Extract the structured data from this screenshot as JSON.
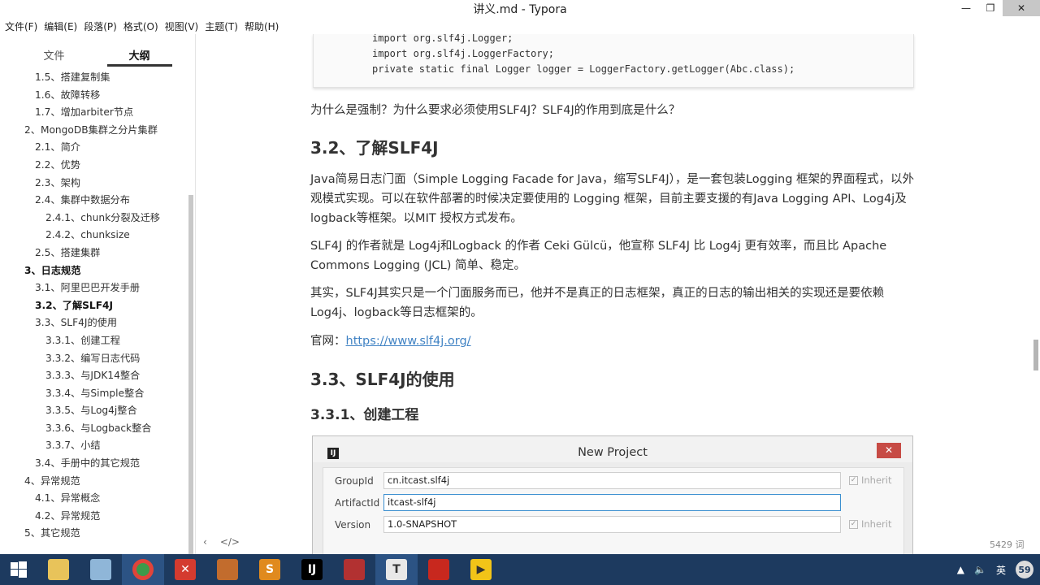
{
  "window": {
    "title": "讲义.md - Typora",
    "controls": {
      "minimize": "—",
      "maximize": "❐",
      "close": "✕"
    }
  },
  "menu": [
    "文件(F)",
    "编辑(E)",
    "段落(P)",
    "格式(O)",
    "视图(V)",
    "主题(T)",
    "帮助(H)"
  ],
  "sidebar": {
    "tabs": [
      "文件",
      "大纲"
    ],
    "active_tab": "大纲",
    "outline": [
      {
        "label": "1.5、搭建复制集",
        "level": 2
      },
      {
        "label": "1.6、故障转移",
        "level": 2
      },
      {
        "label": "1.7、增加arbiter节点",
        "level": 2
      },
      {
        "label": "2、MongoDB集群之分片集群",
        "level": 1
      },
      {
        "label": "2.1、简介",
        "level": 2
      },
      {
        "label": "2.2、优势",
        "level": 2
      },
      {
        "label": "2.3、架构",
        "level": 2
      },
      {
        "label": "2.4、集群中数据分布",
        "level": 2
      },
      {
        "label": "2.4.1、chunk分裂及迁移",
        "level": 3
      },
      {
        "label": "2.4.2、chunksize",
        "level": 3
      },
      {
        "label": "2.5、搭建集群",
        "level": 2
      },
      {
        "label": "3、日志规范",
        "level": 1,
        "bold": true
      },
      {
        "label": "3.1、阿里巴巴开发手册",
        "level": 2
      },
      {
        "label": "3.2、了解SLF4J",
        "level": 2,
        "bold": true
      },
      {
        "label": "3.3、SLF4J的使用",
        "level": 2
      },
      {
        "label": "3.3.1、创建工程",
        "level": 3
      },
      {
        "label": "3.3.2、编写日志代码",
        "level": 3
      },
      {
        "label": "3.3.3、与JDK14整合",
        "level": 3
      },
      {
        "label": "3.3.4、与Simple整合",
        "level": 3
      },
      {
        "label": "3.3.5、与Log4j整合",
        "level": 3
      },
      {
        "label": "3.3.6、与Logback整合",
        "level": 3
      },
      {
        "label": "3.3.7、小结",
        "level": 3
      },
      {
        "label": "3.4、手册中的其它规范",
        "level": 2
      },
      {
        "label": "4、异常规范",
        "level": 1
      },
      {
        "label": "4.1、异常概念",
        "level": 2
      },
      {
        "label": "4.2、异常规范",
        "level": 2
      },
      {
        "label": "5、其它规范",
        "level": 1
      }
    ]
  },
  "editor": {
    "code_lines": [
      "import org.slf4j.Logger;",
      "import org.slf4j.LoggerFactory;",
      "private static final Logger logger = LoggerFactory.getLogger(Abc.class);"
    ],
    "question": "为什么是强制？为什么要求必须使用SLF4J？SLF4J的作用到底是什么？",
    "h_3_2": "3.2、了解SLF4J",
    "p1": "Java简易日志门面（Simple Logging Facade for Java，缩写SLF4J），是一套包装Logging 框架的界面程式，以外观模式实现。可以在软件部署的时候决定要使用的 Logging 框架，目前主要支援的有Java Logging API、Log4j及logback等框架。以MIT 授权方式发布。",
    "p2": "SLF4J 的作者就是 Log4j和Logback 的作者 Ceki Gülcü，他宣称 SLF4J 比 Log4j 更有效率，而且比 Apache Commons Logging (JCL) 简单、稳定。",
    "p3": "其实，SLF4J其实只是一个门面服务而已，他并不是真正的日志框架，真正的日志的输出相关的实现还是要依赖Log4j、logback等日志框架的。",
    "site_label": "官网：",
    "site_url": "https://www.slf4j.org/",
    "h_3_3": "3.3、SLF4J的使用",
    "h_3_3_1": "3.3.1、创建工程",
    "word_count": "5429 词",
    "footer_icons": {
      "back": "‹",
      "source": "</>"
    }
  },
  "dialog": {
    "title": "New Project",
    "logo": "IJ",
    "close": "✕",
    "fields": [
      {
        "label": "GroupId",
        "value": "cn.itcast.slf4j",
        "inherit": "Inherit"
      },
      {
        "label": "ArtifactId",
        "value": "itcast-slf4j",
        "inherit": ""
      },
      {
        "label": "Version",
        "value": "1.0-SNAPSHOT",
        "inherit": "Inherit"
      }
    ]
  },
  "taskbar": {
    "apps": [
      "file-explorer",
      "paint-app",
      "chrome-browser",
      "xmind-app",
      "winrar-app",
      "sublime-app",
      "intellij-app",
      "notebook-app",
      "typora-app",
      "pdf-app",
      "pia-app"
    ],
    "tray": {
      "arrow": "▲",
      "volume": "🔈",
      "ime": "英",
      "badge": "59"
    }
  }
}
